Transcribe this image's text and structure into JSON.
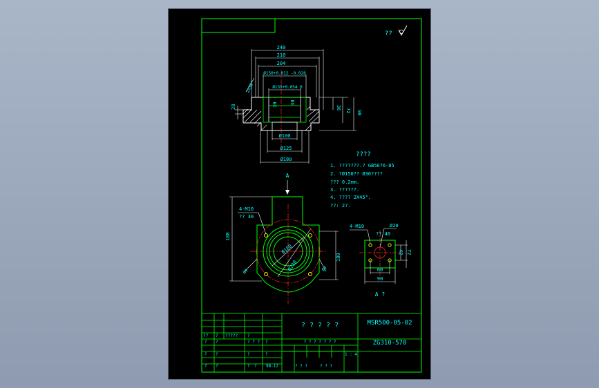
{
  "drawing": {
    "roughness_mark": "??",
    "tech_req_title": "????",
    "tech_req_lines": [
      "1. ???????.?  GB5676-85",
      "2. ?Ø150?? Ø30????",
      "   ??? 0.2mm.",
      "3. ??????.",
      "4. ????  2X45°.",
      "   ??: 2?."
    ],
    "view_label_A": "A",
    "view_caption": "A ?",
    "section_dims": {
      "d240": "240",
      "d210": "210",
      "d204": "204",
      "d150": "Ø150+0.012 -0.028",
      "d135": "Ø135+0.054 0",
      "d100": "Ø100",
      "d125": "Ø125",
      "d180": "Ø180",
      "d36": "36",
      "d72": "72",
      "d90": "90",
      "d28": "28",
      "d10": "10",
      "d30": "30",
      "chamfer": "2X30°"
    },
    "plan_dims": {
      "m10": "4-M10",
      "deep30": "?? 30",
      "d180v": "180",
      "d180h": "180",
      "d180c": "Ø180",
      "d220": "Ø220",
      "d4": "Ø4"
    },
    "detail_dims": {
      "m10": "4-M10",
      "deep40": "?? 40",
      "d20": "Ø20",
      "d42": "42",
      "d72": "72",
      "d60": "60",
      "d90": "90"
    }
  },
  "title_block": {
    "part_name": "? ? ? ? ?",
    "drawing_no": "MSR500-05-02",
    "material": "ZG310-570",
    "scale": "1 : 4",
    "date": "98-12",
    "row_labels_1": [
      "??",
      "?",
      "?????",
      "?"
    ],
    "row_labels_2": [
      "?",
      "?",
      "? ? ?",
      "?"
    ],
    "row_labels_3": [
      "?",
      "?",
      "?",
      "?"
    ],
    "row_labels_4": [
      "?",
      "?",
      "?",
      "?"
    ],
    "mid_labels": [
      "? ? ? ? ? ? ?",
      "? ? ?",
      "? ? ?"
    ]
  },
  "colors": {
    "frame": "#00ff00",
    "outline": "#ffffff",
    "dimension": "#00ffff",
    "center": "#ff2020",
    "hatch": "#ffffff",
    "hole": "#ffff00"
  }
}
